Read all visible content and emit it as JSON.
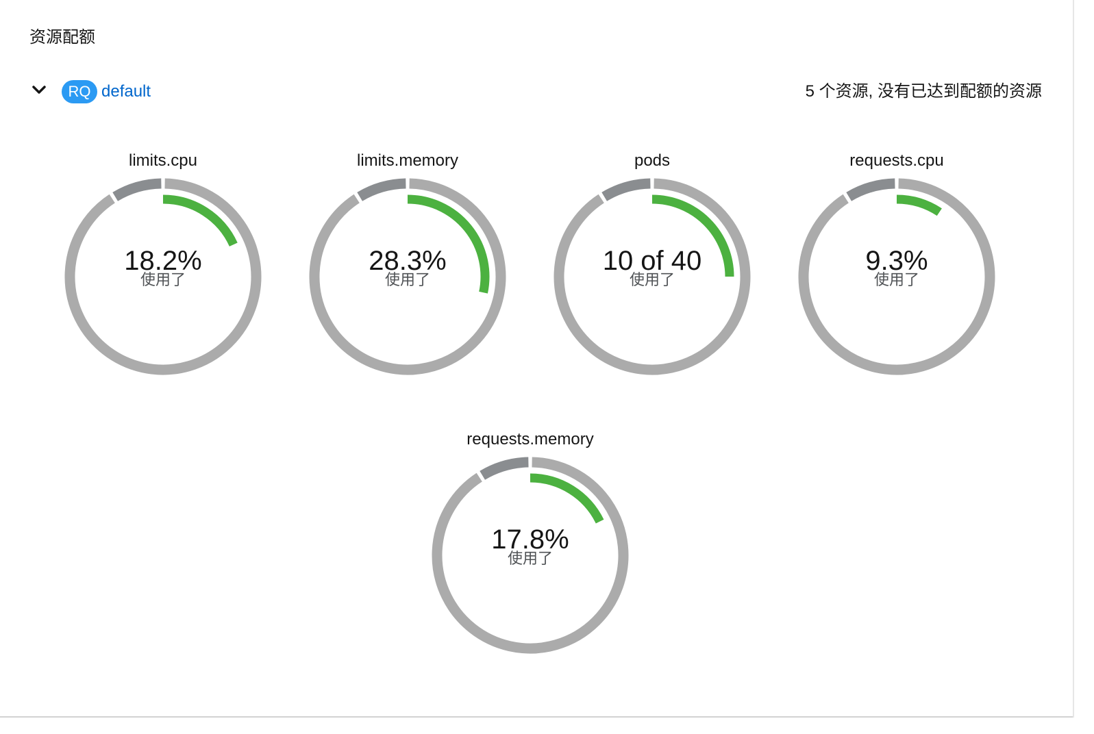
{
  "section": {
    "title": "资源配额"
  },
  "resource_quota": {
    "badge": "RQ",
    "name": "default",
    "summary": "5 个资源, 没有已达到配额的资源",
    "expanded": true
  },
  "colors": {
    "used": "#4cb140",
    "track": "#ababab",
    "reserved": "#8a8d90",
    "badge": "#2b9af3",
    "link": "#0066cc"
  },
  "quotas": [
    {
      "label": "limits.cpu",
      "value_text": "18.2%",
      "sub": "使用了",
      "used_fraction": 0.182
    },
    {
      "label": "limits.memory",
      "value_text": "28.3%",
      "sub": "使用了",
      "used_fraction": 0.283
    },
    {
      "label": "pods",
      "value_text": "10 of 40",
      "sub": "使用了",
      "used_fraction": 0.25
    },
    {
      "label": "requests.cpu",
      "value_text": "9.3%",
      "sub": "使用了",
      "used_fraction": 0.093
    },
    {
      "label": "requests.memory",
      "value_text": "17.8%",
      "sub": "使用了",
      "used_fraction": 0.178
    }
  ]
}
